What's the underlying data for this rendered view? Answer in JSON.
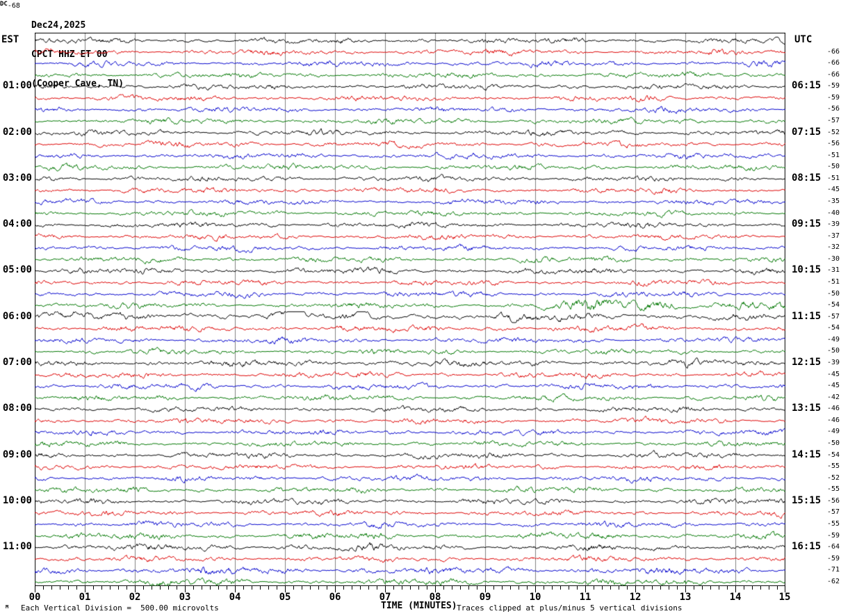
{
  "title": {
    "date": "Dec24,2025",
    "station": "CPCT HHZ ET 00",
    "location": "(Cooper Cave, TN)"
  },
  "axes": {
    "left_header": "EST",
    "right_header": "UTC",
    "dc_header": "DC",
    "x_title": "TIME (MINUTES)",
    "x_tick_labels": [
      "00",
      "01",
      "02",
      "03",
      "04",
      "05",
      "06",
      "07",
      "08",
      "09",
      "10",
      "11",
      "12",
      "13",
      "14",
      "15"
    ]
  },
  "footer": {
    "scale_note": "Each Vertical Division =  500.00 microvolts",
    "clip_note": "Traces clipped at plus/minus 5 vertical divisions",
    "corner_mark": "M"
  },
  "colors": {
    "grid": "#808080",
    "border": "#000000",
    "trace_cycle": [
      "#000000",
      "#dd0000",
      "#0000cc",
      "#007700"
    ]
  },
  "chart_data": {
    "type": "line",
    "description": "Helicorder seismogram: 48 consecutive 15-minute traces, 4 per hour, color cycle black/red/blue/green. X axis 0-15 minutes, minor ticks every 10 seconds. Traces clipped at plus/minus 5 vertical divisions, each vertical division 500.00 microvolts.",
    "x_range_minutes": [
      0,
      15
    ],
    "rows": [
      {
        "dc": "-68"
      },
      {
        "dc": "-66"
      },
      {
        "dc": "-66"
      },
      {
        "dc": "-66"
      },
      {
        "est": "01:00",
        "utc": "06:15",
        "dc": "-59"
      },
      {
        "dc": "-59"
      },
      {
        "dc": "-56"
      },
      {
        "dc": "-57"
      },
      {
        "est": "02:00",
        "utc": "07:15",
        "dc": "-52"
      },
      {
        "dc": "-56"
      },
      {
        "dc": "-51"
      },
      {
        "dc": "-50"
      },
      {
        "est": "03:00",
        "utc": "08:15",
        "dc": "-51"
      },
      {
        "dc": "-45"
      },
      {
        "dc": "-35"
      },
      {
        "dc": "-40"
      },
      {
        "est": "04:00",
        "utc": "09:15",
        "dc": "-39"
      },
      {
        "dc": "-37"
      },
      {
        "dc": "-32"
      },
      {
        "dc": "-30"
      },
      {
        "est": "05:00",
        "utc": "10:15",
        "dc": "-31",
        "amp": 1.1
      },
      {
        "dc": "-51"
      },
      {
        "dc": "-50"
      },
      {
        "dc": "-54",
        "burst": {
          "from_minute": 10,
          "amp": 2.2,
          "smooth": 0.9
        }
      },
      {
        "est": "06:00",
        "utc": "11:15",
        "dc": "-57",
        "amp": 2.2,
        "smooth": 0.93,
        "drive": 1.7
      },
      {
        "dc": "-54",
        "amp": 1.1
      },
      {
        "dc": "-49"
      },
      {
        "dc": "-50"
      },
      {
        "est": "07:00",
        "utc": "12:15",
        "dc": "-39",
        "amp": 1.15
      },
      {
        "dc": "-45"
      },
      {
        "dc": "-45"
      },
      {
        "dc": "-42"
      },
      {
        "est": "08:00",
        "utc": "13:15",
        "dc": "-46"
      },
      {
        "dc": "-46"
      },
      {
        "dc": "-49"
      },
      {
        "dc": "-50"
      },
      {
        "est": "09:00",
        "utc": "14:15",
        "dc": "-54"
      },
      {
        "dc": "-55"
      },
      {
        "dc": "-52"
      },
      {
        "dc": "-55"
      },
      {
        "est": "10:00",
        "utc": "15:15",
        "dc": "-56"
      },
      {
        "dc": "-57"
      },
      {
        "dc": "-55"
      },
      {
        "dc": "-59",
        "amp": 1.15
      },
      {
        "est": "11:00",
        "utc": "16:15",
        "dc": "-64",
        "amp": 1.2
      },
      {
        "dc": "-59"
      },
      {
        "dc": "-71",
        "amp": 1.3
      },
      {
        "dc": "-62",
        "amp": 1.15
      }
    ]
  }
}
